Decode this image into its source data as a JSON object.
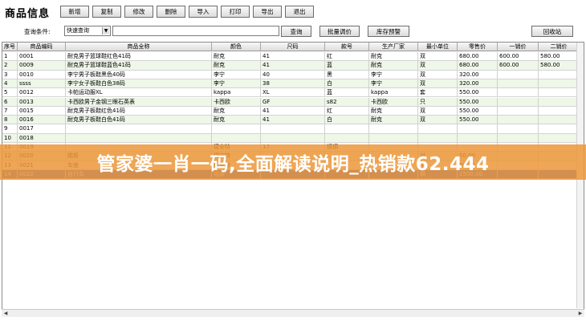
{
  "app_title": "商品信息",
  "toolbar": [
    {
      "key": "add",
      "label": "新增"
    },
    {
      "key": "copy",
      "label": "复制"
    },
    {
      "key": "edit",
      "label": "修改"
    },
    {
      "key": "delete",
      "label": "删除"
    },
    {
      "key": "import",
      "label": "导入"
    },
    {
      "key": "print",
      "label": "打印"
    },
    {
      "key": "export",
      "label": "导出"
    },
    {
      "key": "exit",
      "label": "退出"
    }
  ],
  "search": {
    "label": "查询条件:",
    "mode": "快速查询",
    "query": "",
    "search_btn": "查询",
    "batch_btn": "批量调价",
    "stock_btn": "库存预警",
    "recycle_btn": "回收站"
  },
  "columns": [
    "序号",
    "商品编码",
    "商品全称",
    "颜色",
    "尺码",
    "款号",
    "生产厂家",
    "最小单位",
    "零售价",
    "一销价",
    "二销价"
  ],
  "rows": [
    [
      "1",
      "0001",
      "耐克男子篮球鞋红色41码",
      "耐克",
      "41",
      "红",
      "耐克",
      "双",
      "680.00",
      "600.00",
      "580.00"
    ],
    [
      "2",
      "0009",
      "耐克男子篮球鞋蓝色41码",
      "耐克",
      "41",
      "蓝",
      "耐克",
      "双",
      "680.00",
      "600.00",
      "580.00"
    ],
    [
      "3",
      "0010",
      "李宁男子板鞋黑色40码",
      "李宁",
      "40",
      "黑",
      "李宁",
      "双",
      "320.00",
      "",
      ""
    ],
    [
      "4",
      "ssss",
      "李宁女子板鞋白色38码",
      "李宁",
      "38",
      "白",
      "李宁",
      "双",
      "320.00",
      "",
      ""
    ],
    [
      "5",
      "0012",
      "卡帕运动服XL",
      "kappa",
      "XL",
      "蓝",
      "kappa",
      "套",
      "550.00",
      "",
      ""
    ],
    [
      "6",
      "0013",
      "卡西欧男子金钢三眼石英表",
      "卡西欧",
      "GF",
      "s82",
      "卡西欧",
      "只",
      "550.00",
      "",
      ""
    ],
    [
      "7",
      "0015",
      "耐克男子板鞋红色41码",
      "耐克",
      "41",
      "红",
      "耐克",
      "双",
      "550.00",
      "",
      ""
    ],
    [
      "8",
      "0016",
      "耐克男子板鞋白色41码",
      "耐克",
      "41",
      "白",
      "耐克",
      "双",
      "550.00",
      "",
      ""
    ],
    [
      "9",
      "0017",
      "",
      "",
      "",
      "",
      "",
      "",
      "",
      "",
      ""
    ],
    [
      "10",
      "0018",
      "",
      "",
      "",
      "",
      "",
      "",
      "",
      "",
      ""
    ],
    [
      "11",
      "0019",
      "",
      "捷安特",
      "17",
      "银钢",
      "",
      "",
      "",
      "",
      ""
    ],
    [
      "12",
      "0020",
      "踏板",
      "捷安特",
      "",
      "",
      "",
      "对",
      "50.00",
      "",
      ""
    ],
    [
      "13",
      "0021",
      "车座",
      "捷安特",
      "",
      "",
      "",
      "个",
      "80.00",
      "",
      ""
    ],
    [
      "14",
      "0022",
      "自行车",
      "组装",
      "",
      "",
      "",
      "辆",
      "2500.00",
      "",
      ""
    ]
  ],
  "selected_row": 13,
  "watermark": "管家婆一肖一码,全面解读说明_热销款62.444"
}
